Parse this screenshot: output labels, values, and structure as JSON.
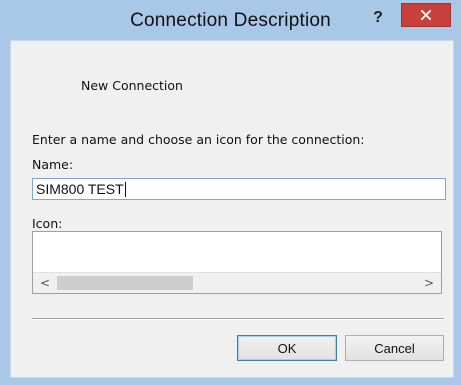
{
  "window": {
    "title": "Connection Description",
    "help_glyph": "?",
    "close_icon": "close-icon"
  },
  "dialog": {
    "connection_name_display": "New Connection",
    "instructions": "Enter a name and choose an icon for the connection:",
    "name_label": "Name:",
    "name_value": "SIM800 TEST",
    "icon_label": "Icon:",
    "scroll_left_glyph": "<",
    "scroll_right_glyph": ">"
  },
  "buttons": {
    "ok_label": "OK",
    "cancel_label": "Cancel"
  },
  "colors": {
    "titlebar": "#a9c7e6",
    "close_button": "#c7403a",
    "client_background": "#f0f0f0"
  }
}
